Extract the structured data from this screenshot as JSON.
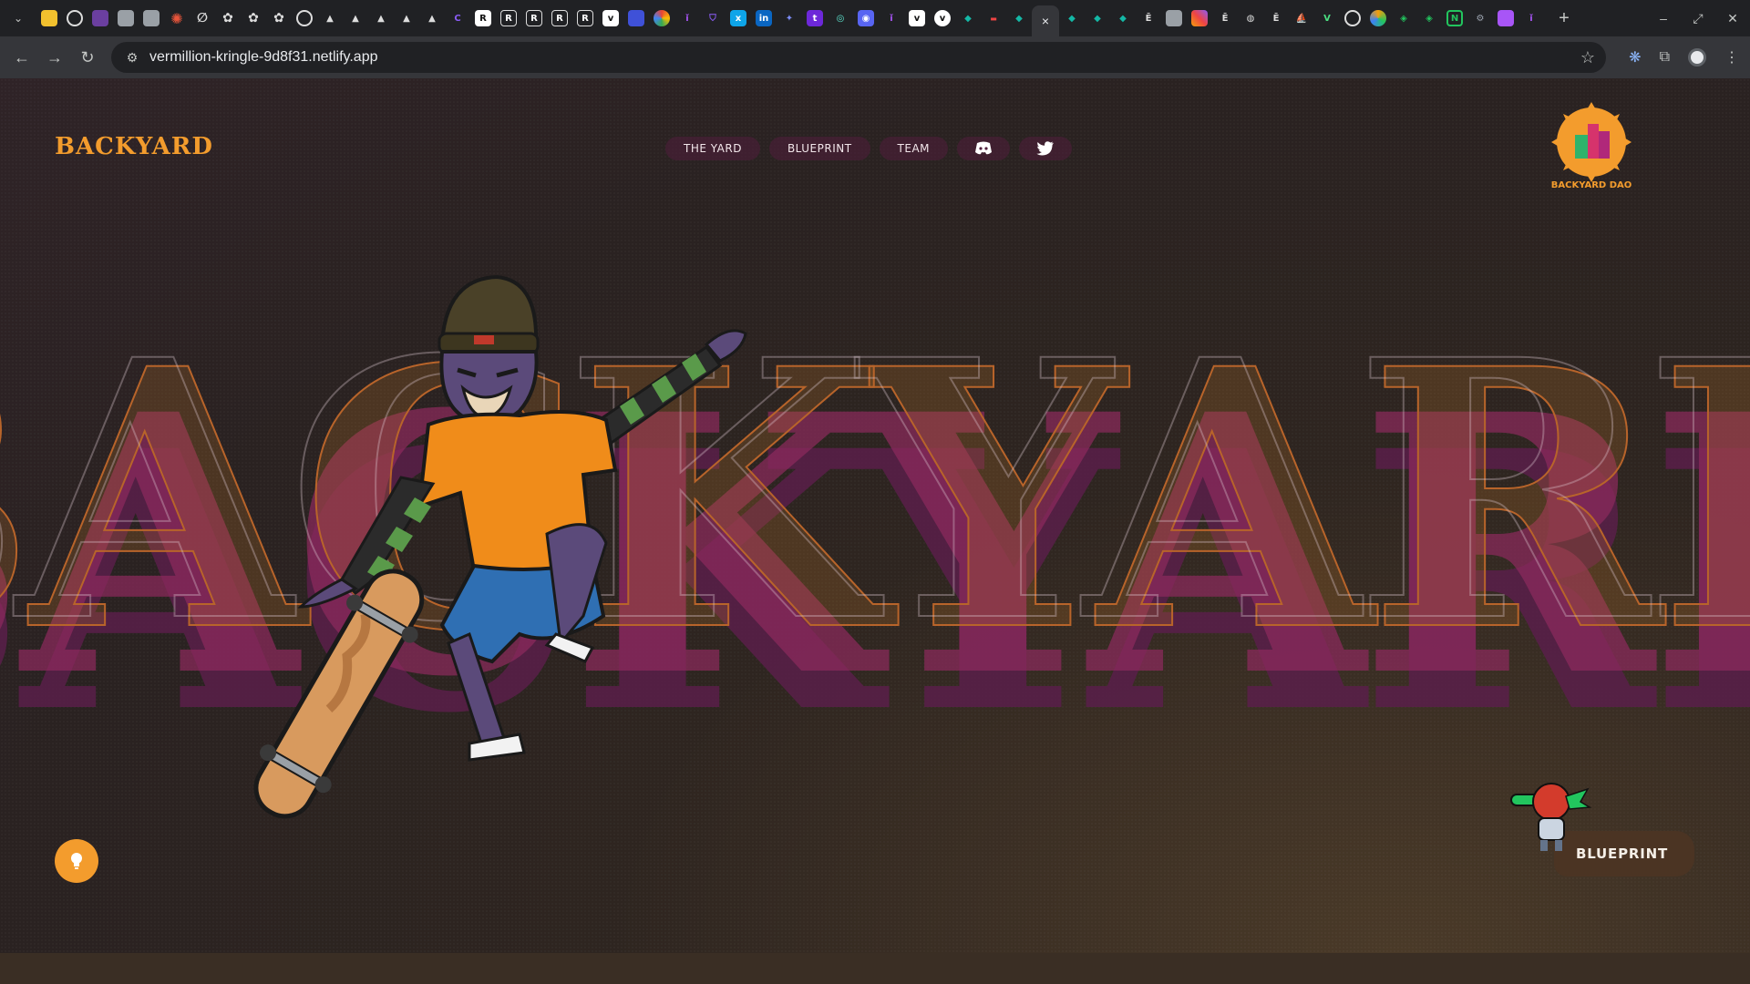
{
  "browser": {
    "url": "vermillion-kringle-9d8f31.netlify.app",
    "tab_favicons": [
      "yellow",
      "github",
      "purple",
      "camera",
      "camera",
      "red-asterisk",
      "circle-slash",
      "openai",
      "openai",
      "openai",
      "github",
      "triangle",
      "triangle",
      "triangle",
      "triangle",
      "triangle",
      "triangle",
      "c",
      "R",
      "R",
      "R",
      "R",
      "R",
      "vd",
      "blue",
      "multicolor",
      "purple",
      "shield",
      "xo",
      "in",
      "puzzle",
      "t",
      "spiral",
      "discord",
      "purple",
      "vd",
      "vd",
      "teal",
      "red",
      "teal"
    ],
    "active_tab_close": "×",
    "new_tab": "+",
    "window_controls": [
      "–",
      "⤢",
      "✕"
    ]
  },
  "site": {
    "brand": "BACKYARD",
    "nav": {
      "the_yard": "THE YARD",
      "blueprint": "BLUEPRINT",
      "team": "TEAM"
    },
    "dao_label": "BACKYARD DAO",
    "hero_word": "BACKYARD",
    "blueprint_card": "BLUEPRINT"
  },
  "colors": {
    "accent": "#f39c2d",
    "pink": "#8e2a5e",
    "nav_bg": "#501e3c"
  },
  "icons": {
    "discord": "discord-icon",
    "twitter": "twitter-icon",
    "hint": "lightbulb-icon"
  }
}
